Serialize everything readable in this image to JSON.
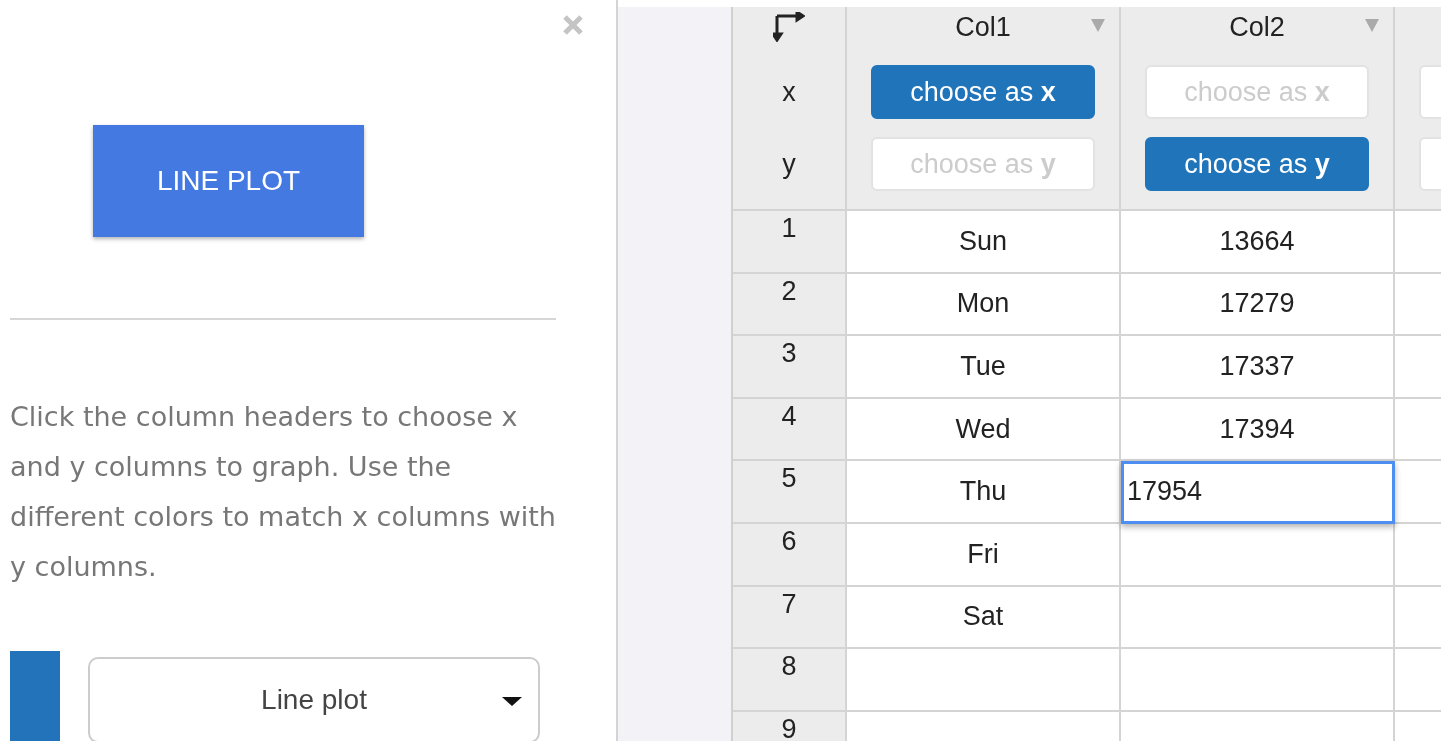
{
  "sidebar": {
    "plot_button": "LINE PLOT",
    "instructions": "Click the column headers to choose x and y columns to graph. Use the different colors to match x columns with y columns.",
    "series": [
      {
        "color": "#2273b9",
        "chart_type": "Line plot"
      }
    ]
  },
  "grid": {
    "axis_labels": [
      "x",
      "y"
    ],
    "columns": [
      {
        "name": "Col1",
        "x_chip": {
          "label": "choose as **x**",
          "selected": true
        },
        "y_chip": {
          "label": "choose as **y**",
          "selected": false
        }
      },
      {
        "name": "Col2",
        "x_chip": {
          "label": "choose as **x**",
          "selected": false
        },
        "y_chip": {
          "label": "choose as **y**",
          "selected": true
        }
      },
      {
        "x_chip": {
          "selected": false
        },
        "y_chip": {
          "selected": false
        }
      }
    ],
    "rows": [
      {
        "number": "1",
        "cells": [
          {
            "text": "Sun",
            "selected": false
          },
          {
            "text": "13664",
            "selected": false
          },
          {
            "selected": false
          }
        ]
      },
      {
        "number": "2",
        "cells": [
          {
            "text": "Mon",
            "selected": false
          },
          {
            "text": "17279",
            "selected": false
          },
          {
            "selected": false
          }
        ]
      },
      {
        "number": "3",
        "cells": [
          {
            "text": "Tue",
            "selected": false
          },
          {
            "text": "17337",
            "selected": false
          },
          {
            "selected": false
          }
        ]
      },
      {
        "number": "4",
        "cells": [
          {
            "text": "Wed",
            "selected": false
          },
          {
            "text": "17394",
            "selected": false
          },
          {
            "selected": false
          }
        ]
      },
      {
        "number": "5",
        "cells": [
          {
            "text": "Thu",
            "selected": false
          },
          {
            "text": "17954",
            "selected": true
          },
          {
            "selected": false
          }
        ]
      },
      {
        "number": "6",
        "cells": [
          {
            "text": "Fri",
            "selected": false
          },
          {
            "selected": false
          },
          {
            "selected": false
          }
        ]
      },
      {
        "number": "7",
        "cells": [
          {
            "text": "Sat",
            "selected": false
          },
          {
            "selected": false
          },
          {
            "selected": false
          }
        ]
      },
      {
        "number": "8",
        "cells": [
          {
            "selected": false
          },
          {
            "selected": false
          },
          {
            "selected": false
          }
        ]
      },
      {
        "number": "9",
        "cells": [
          {
            "selected": false
          },
          {
            "selected": false
          }
        ]
      }
    ]
  }
}
